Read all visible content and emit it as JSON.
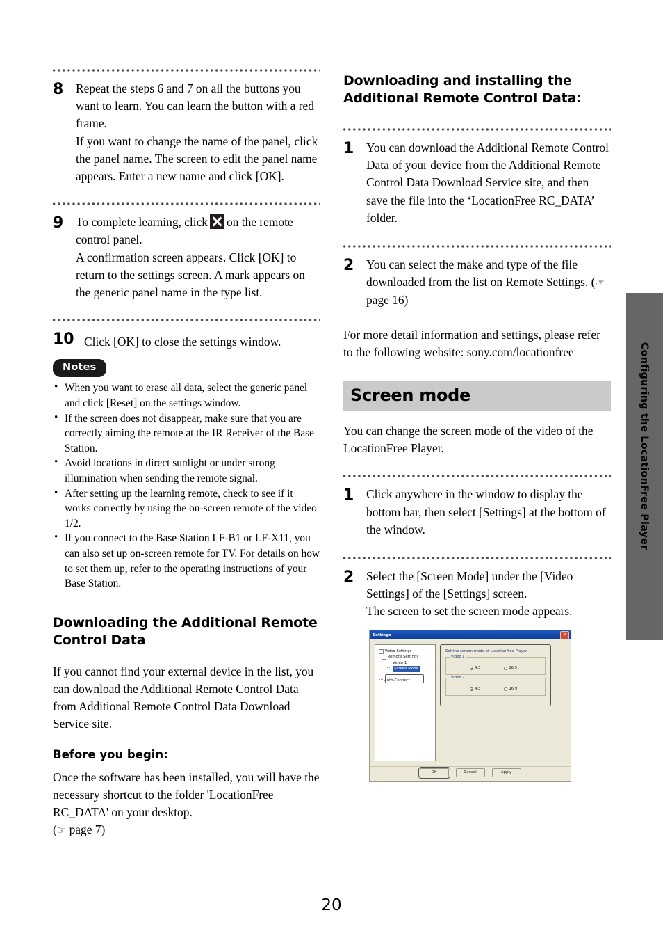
{
  "page": {
    "number": "20",
    "side_tab_label": "Configuring the LocationFree Player",
    "side_tab_color": "#666666",
    "band_color": "#cacaca"
  },
  "left_column": {
    "steps": [
      {
        "number": "8",
        "paragraphs": [
          "Repeat the steps 6 and 7 on all the buttons you want to learn. You can learn the button with a red frame.",
          "If you want to change the name of the panel, click the panel name. The screen to edit the panel name appears. Enter a new name and click [OK]."
        ]
      },
      {
        "number": "9",
        "text_before_icon": "To complete learning, click",
        "icon": "close-x-icon",
        "text_after_icon": "on the remote control panel.",
        "paragraphs": [
          "A confirmation screen appears. Click [OK] to return to the settings screen. A mark appears on the generic panel name in the type list."
        ]
      },
      {
        "number": "10",
        "paragraphs": [
          "Click [OK] to close the settings window."
        ]
      }
    ],
    "notes": {
      "badge": "Notes",
      "items": [
        "When you want to erase all data, select the generic panel and click [Reset] on the settings window.",
        "If the screen does not disappear, make sure that you are correctly aiming the remote at the IR Receiver of the Base Station.",
        "Avoid locations in direct sunlight or under strong illumination when sending the remote signal.",
        "After setting up the learning remote, check to see if it works correctly by using the on-screen remote of the video 1/2.",
        "If you connect to the Base Station LF-B1 or LF-X11, you can also set up on-screen remote for TV. For details on how to set them up, refer to the operating instructions of your Base Station."
      ]
    },
    "download_section": {
      "heading": "Downloading the Additional Remote Control Data",
      "body": "If you cannot find your external device in the list, you can download the Additional Remote Control Data from Additional Remote Control Data Download Service site.",
      "subheading": "Before you begin:",
      "body2": "Once the software has been installed, you will have the necessary shortcut to the folder 'LocationFree RC_DATA' on your desktop.",
      "page_ref_open": "(",
      "page_ref_icon": "pointing-hand-icon",
      "page_ref_text": " page 7)"
    }
  },
  "right_column": {
    "install_section": {
      "heading": "Downloading and installing the Additional Remote Control Data:",
      "steps": [
        {
          "number": "1",
          "paragraphs": [
            "You can download the Additional Remote Control Data of your device from the Additional Remote Control Data Download Service site, and then save the file into the ‘LocationFree RC_DATA’ folder."
          ]
        },
        {
          "number": "2",
          "text_before_ref": "You can select the make and type of the file downloaded from the list on Remote Settings. (",
          "ref_icon": "pointing-hand-icon",
          "text_after_ref": " page 16)"
        }
      ],
      "footer": "For more detail information and settings, please refer to the following website: sony.com/locationfree"
    },
    "screen_mode": {
      "band_title": "Screen mode",
      "intro": "You can change the screen mode of the video of the LocationFree Player.",
      "steps": [
        {
          "number": "1",
          "paragraphs": [
            "Click anywhere in the window to display the bottom bar, then select [Settings] at the bottom of the window."
          ]
        },
        {
          "number": "2",
          "paragraphs": [
            "Select the [Screen Mode] under the [Video Settings] of the [Settings] screen.",
            "The screen to set the screen mode appears."
          ]
        }
      ]
    }
  },
  "dialog_screenshot": {
    "title": "Settings",
    "close_label": "✕",
    "tree": [
      {
        "label": "Video Settings",
        "level": 0,
        "toggle": "-",
        "selected": false
      },
      {
        "label": "Remote Settings",
        "level": 1,
        "toggle": "-",
        "selected": false
      },
      {
        "label": "Video 1",
        "level": 2,
        "toggle": "",
        "selected": false
      },
      {
        "label": "Screen Mode",
        "level": 2,
        "toggle": "",
        "selected": true
      },
      {
        "label": "Auto-Connect",
        "level": 0,
        "toggle": "",
        "selected": false
      }
    ],
    "panel_caption": "Set the screen mode of LocationFree Player.",
    "groups": [
      {
        "legend": "Video 1",
        "options": [
          {
            "label": "4:3",
            "selected": true
          },
          {
            "label": "16:9",
            "selected": false
          }
        ]
      },
      {
        "legend": "Video 2",
        "options": [
          {
            "label": "4:3",
            "selected": true
          },
          {
            "label": "16:9",
            "selected": false
          }
        ]
      }
    ],
    "buttons": [
      {
        "label": "OK",
        "focused": true
      },
      {
        "label": "Cancel",
        "focused": false
      },
      {
        "label": "Apply",
        "focused": false
      }
    ]
  }
}
